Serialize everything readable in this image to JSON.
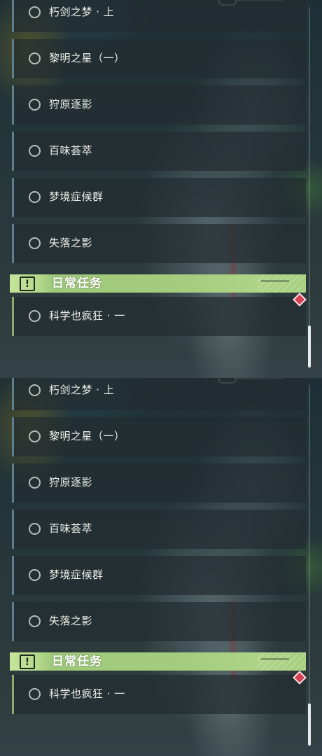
{
  "quests": {
    "items": [
      {
        "label": "朽剑之梦 · 上"
      },
      {
        "label": "黎明之星（一）"
      },
      {
        "label": "狩原逐影"
      },
      {
        "label": "百味荟萃"
      },
      {
        "label": "梦境症候群"
      },
      {
        "label": "失落之影"
      }
    ],
    "daily_section": {
      "title": "日常任务",
      "icon": "alert-icon",
      "items": [
        {
          "label": "科学也疯狂 · 一",
          "tracked": true
        }
      ]
    }
  },
  "colors": {
    "section_header": "#a6cf80",
    "quest_accent": "#5e7f8c",
    "daily_accent": "#8dac6a",
    "track_marker": "#d64052"
  }
}
